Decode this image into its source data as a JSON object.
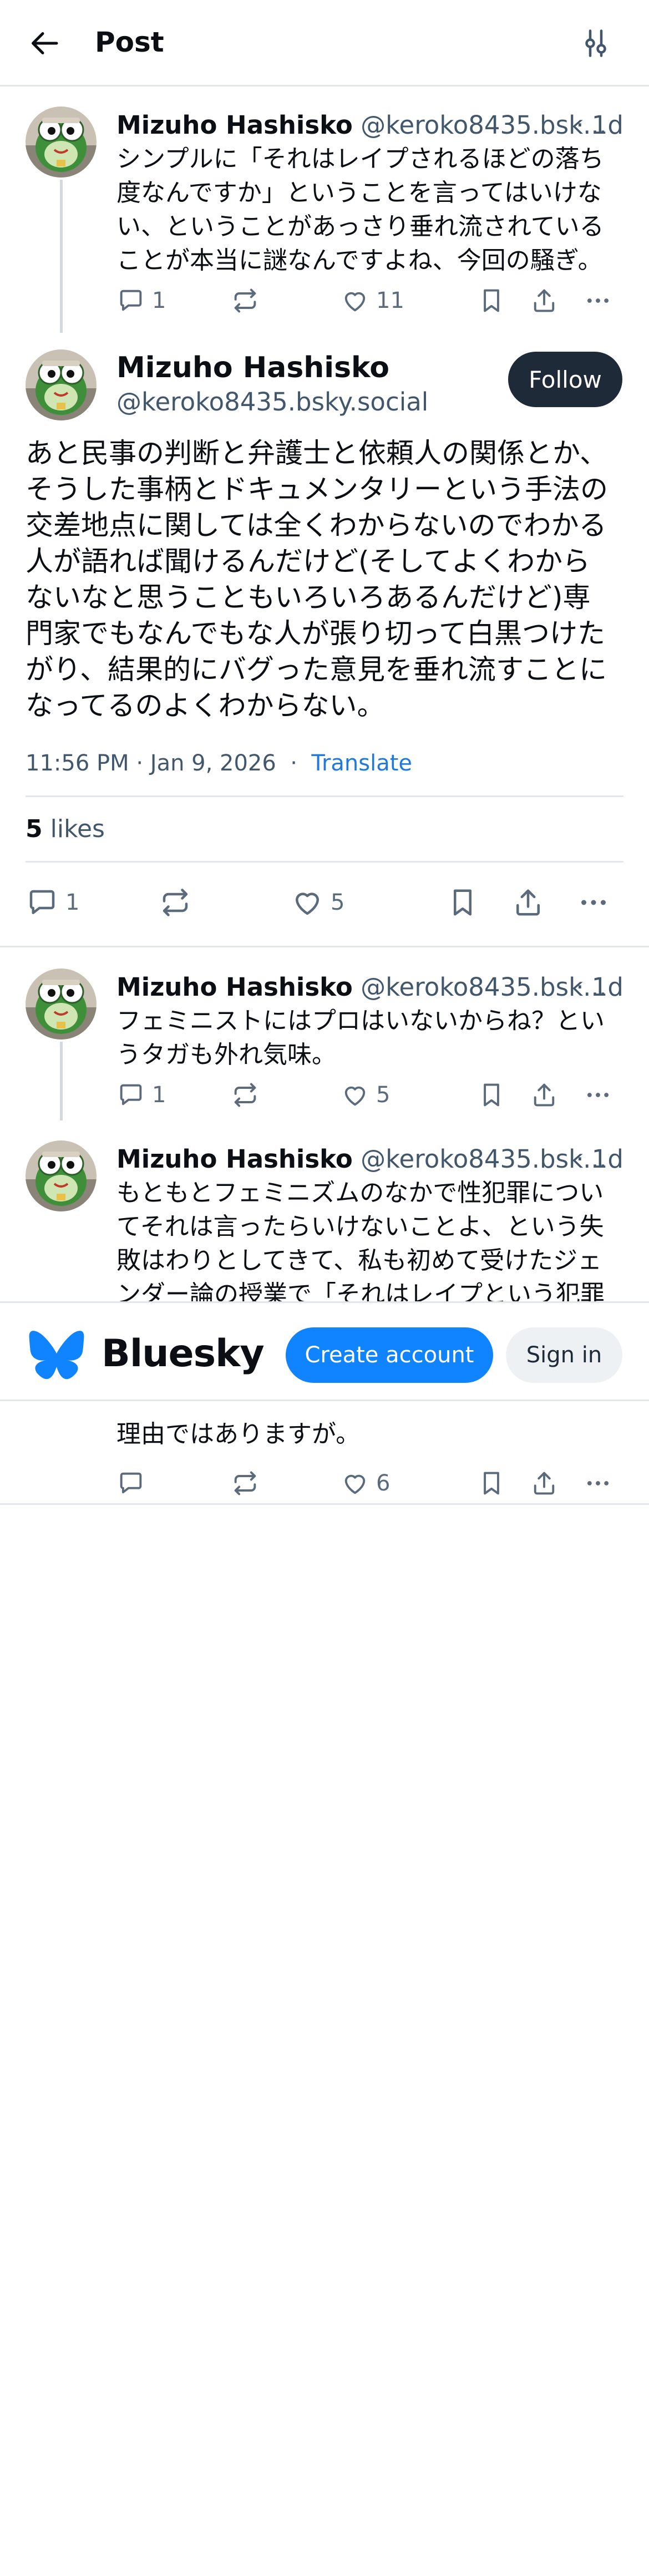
{
  "header": {
    "title": "Post",
    "back_icon": "arrow-left-icon",
    "filter_icon": "sliders-icon"
  },
  "parent_post": {
    "name": "Mizuho Hashisko",
    "handle": "@keroko8435.bsk...",
    "time": "· 1d",
    "lines": [
      "シンプルに「それはレイプされるほどの落ち",
      "度なんですか」ということを言ってはいけな",
      "い、ということがあっさり垂れ流されている",
      "ことが本当に謎なんですよね、今回の騒ぎ。"
    ],
    "reply_count": "1",
    "like_count": "11"
  },
  "main_post": {
    "name": "Mizuho Hashisko",
    "handle": "@keroko8435.bsky.social",
    "follow_label": "Follow",
    "lines": [
      "あと民事の判断と弁護士と依頼人の関係とか、",
      "そうした事柄とドキュメンタリーという手法の",
      "交差地点に関しては全くわからないのでわかる",
      "人が語れば聞けるんだけど(そしてよくわから",
      "ないなと思うこともいろいろあるんだけど)専",
      "門家でもなんでもな人が張り切って白黒つけた",
      "がり、結果的にバグった意見を垂れ流すことに",
      "なってるのよくわからない。"
    ],
    "timestamp": "11:56 PM · Jan 9, 2026",
    "separator": "·",
    "translate_label": "Translate",
    "likes_count": "5",
    "likes_label": "likes",
    "reply_count": "1",
    "like_count": "5"
  },
  "replies": [
    {
      "name": "Mizuho Hashisko",
      "handle": "@keroko8435.bsk...",
      "time": "· 1d",
      "lines": [
        "フェミニストにはプロはいないからね？とい",
        "うタガも外れ気味。"
      ],
      "reply_count": "1",
      "like_count": "5"
    },
    {
      "name": "Mizuho Hashisko",
      "handle": "@keroko8435.bsk...",
      "time": "· 1d",
      "lines": [
        "もともとフェミニズムのなかで性犯罪につい",
        "てそれは言ったらいけないことよ、という失",
        "敗はわりとしてきて、私も初めて受けたジェ",
        "ンダー論の授業で「それはレイプという犯罪"
      ],
      "bottom_line": "理由ではありますが。",
      "reply_count": "",
      "like_count": "6"
    }
  ],
  "banner": {
    "brand": "Bluesky",
    "create_account_label": "Create account",
    "sign_in_label": "Sign in",
    "brand_color": "#1083fe"
  },
  "icons": {
    "reply": "speech-bubble-icon",
    "repost": "repost-arrows-icon",
    "like": "heart-icon",
    "bookmark": "bookmark-icon",
    "share": "share-upload-icon",
    "more": "ellipsis-icon"
  }
}
